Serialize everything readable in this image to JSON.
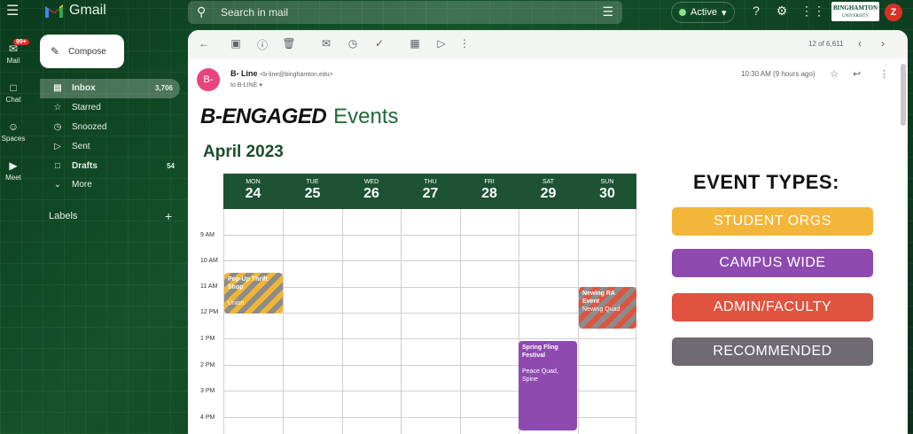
{
  "app": {
    "name": "Gmail",
    "menu_icon": "hamburger-icon"
  },
  "search": {
    "placeholder": "Search in mail"
  },
  "status": {
    "label": "Active",
    "color": "#8ee08a"
  },
  "account": {
    "org_logo": "BINGHAMTON UNIVERSITY",
    "avatar_letter": "Z"
  },
  "rail": {
    "mail": {
      "label": "Mail",
      "badge": "99+"
    },
    "chat": {
      "label": "Chat"
    },
    "spaces": {
      "label": "Spaces"
    },
    "meet": {
      "label": "Meet"
    }
  },
  "compose": {
    "label": "Compose"
  },
  "nav": [
    {
      "label": "Inbox",
      "count": "3,706",
      "icon": "inbox-icon",
      "selected": true
    },
    {
      "label": "Starred",
      "count": "",
      "icon": "star-icon"
    },
    {
      "label": "Snoozed",
      "count": "",
      "icon": "clock-icon"
    },
    {
      "label": "Sent",
      "count": "",
      "icon": "send-icon"
    },
    {
      "label": "Drafts",
      "count": "54",
      "icon": "draft-icon",
      "bold": true
    },
    {
      "label": "More",
      "count": "",
      "icon": "chevron-down-icon"
    }
  ],
  "labels": {
    "title": "Labels"
  },
  "email": {
    "pager": "12 of 6,611",
    "sender_initials": "B-",
    "sender_name": "B- Line",
    "sender_email": "<b-line@binghamton.edu>",
    "to": "to B-LINE",
    "time": "10:30 AM (9 hours ago)",
    "avatar_color": "#e8457f"
  },
  "newsletter": {
    "brand_bold": "B-ENGAGED",
    "brand_light": "Events",
    "month": "April 2023",
    "days": [
      {
        "name": "MON",
        "date": "24"
      },
      {
        "name": "TUE",
        "date": "25"
      },
      {
        "name": "WED",
        "date": "26"
      },
      {
        "name": "THU",
        "date": "27"
      },
      {
        "name": "FRI",
        "date": "28"
      },
      {
        "name": "SAT",
        "date": "29"
      },
      {
        "name": "SUN",
        "date": "30"
      }
    ],
    "times": [
      "9 AM",
      "10 AM",
      "11 AM",
      "12 PM",
      "1 PM",
      "2 PM",
      "3 PM",
      "4 PM"
    ],
    "events": [
      {
        "title": "Pop-Up Thrift Shop",
        "location": "Union",
        "day": "MON"
      },
      {
        "title": "Newing RA Event",
        "location": "Newing Quad",
        "day": "SUN"
      },
      {
        "title": "Spring Fling Festival",
        "location": "Peace Quad, Spine",
        "day": "SAT"
      }
    ],
    "event_types_title": "EVENT TYPES:",
    "event_types": [
      {
        "label": "STUDENT ORGS",
        "color": "#f4b63a"
      },
      {
        "label": "CAMPUS WIDE",
        "color": "#8f4ab0"
      },
      {
        "label": "ADMIN/FACULTY",
        "color": "#e0533f"
      },
      {
        "label": "RECOMMENDED",
        "color": "#6f6a72"
      }
    ],
    "header_color": "#1d5234"
  }
}
